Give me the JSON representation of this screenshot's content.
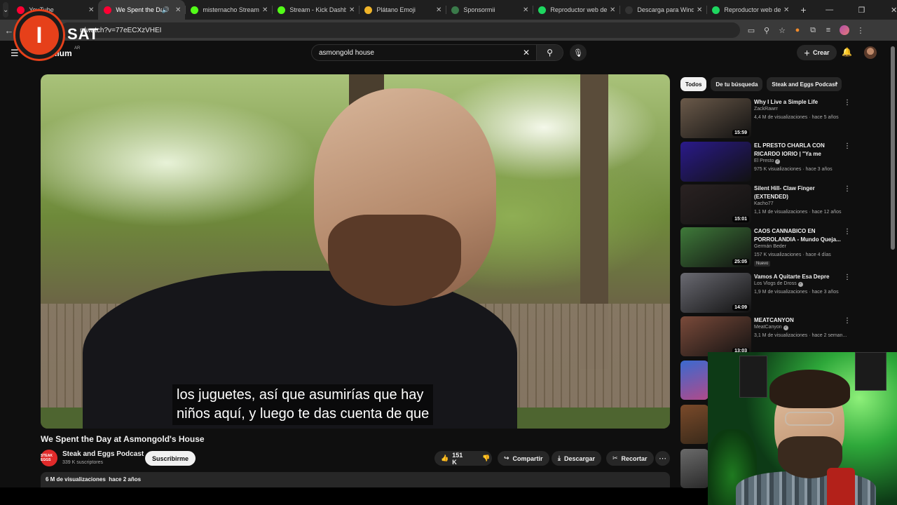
{
  "browser": {
    "tabs": [
      {
        "title": "YouTube",
        "fav_color": "#ff0033",
        "active": false
      },
      {
        "title": "We Spent the Day",
        "fav_color": "#ff0033",
        "active": true
      },
      {
        "title": "misternacho Stream",
        "fav_color": "#53fc18",
        "active": false
      },
      {
        "title": "Stream - Kick Dashbo",
        "fav_color": "#53fc18",
        "active": false
      },
      {
        "title": "Plátano Emoji",
        "fav_color": "#f0b429",
        "active": false
      },
      {
        "title": "Sponsormii",
        "fav_color": "#3a7a4a",
        "active": false
      },
      {
        "title": "Reproductor web de",
        "fav_color": "#1ed760",
        "active": false
      },
      {
        "title": "Descarga para Windo",
        "fav_color": "#333333",
        "active": false
      },
      {
        "title": "Reproductor web de",
        "fav_color": "#1ed760",
        "active": false
      }
    ],
    "url": "n/watch?v=77eECXzVHEI"
  },
  "overlay_logo": {
    "letter": "I",
    "text": "SAT"
  },
  "yt_header": {
    "logo": "emium",
    "region": "AR",
    "search_query": "asmongold house",
    "create_label": "Crear"
  },
  "video": {
    "caption_line1": "los juguetes, así que asumirías que hay",
    "caption_line2": "niños aquí, y luego te das cuenta de que",
    "title": "We Spent the Day at Asmongold's House",
    "channel_name": "Steak and Eggs Podcast",
    "channel_avatar_text": "STEAK EGGS",
    "subscribers": "339 K suscriptores",
    "subscribe_label": "Suscribirme",
    "likes": "151 K",
    "share_label": "Compartir",
    "download_label": "Descargar",
    "clip_label": "Recortar",
    "views": "6 M de visualizaciones",
    "age": "hace 2 años"
  },
  "sidebar": {
    "chips": [
      "Todos",
      "De tu búsqueda",
      "Steak and Eggs Podcast"
    ],
    "items": [
      {
        "title": "Why I Live a Simple Life",
        "channel": "ZackRawrr",
        "verified": false,
        "meta": "4,4 M de visualizaciones · hace 5 años",
        "duration": "15:59",
        "thumb": "#6b5a4a",
        "badge": ""
      },
      {
        "title": "EL PRESTO CHARLA CON RICARDO IORIO | \"Ya me estoy...",
        "channel": "El Presto",
        "verified": true,
        "meta": "975 K visualizaciones · hace 3 años",
        "duration": "",
        "thumb": "#2a1a8a",
        "badge": ""
      },
      {
        "title": "Silent Hill- Claw Finger (EXTENDED)",
        "channel": "Kacho77",
        "verified": false,
        "meta": "1,1 M de visualizaciones · hace 12 años",
        "duration": "15:01",
        "thumb": "#2a2222",
        "badge": ""
      },
      {
        "title": "CAOS CANNABICO EN PORROLANDIA - Mundo Queja...",
        "channel": "Germán Beder",
        "verified": false,
        "meta": "157 K visualizaciones · hace 4 días",
        "duration": "25:05",
        "thumb": "#3f7a3a",
        "badge": "Nuevo"
      },
      {
        "title": "Vamos A Quitarte Esa Depre",
        "channel": "Los Vlogs de Dross",
        "verified": true,
        "meta": "1,9 M de visualizaciones · hace 3 años",
        "duration": "14:09",
        "thumb": "#6a6a72",
        "badge": ""
      },
      {
        "title": "MEATCANYON",
        "channel": "MeatCanyon",
        "verified": true,
        "meta": "3,1 M de visualizaciones · hace 2 seman...",
        "duration": "13:03",
        "thumb": "#7a4a3a",
        "badge": ""
      }
    ]
  }
}
